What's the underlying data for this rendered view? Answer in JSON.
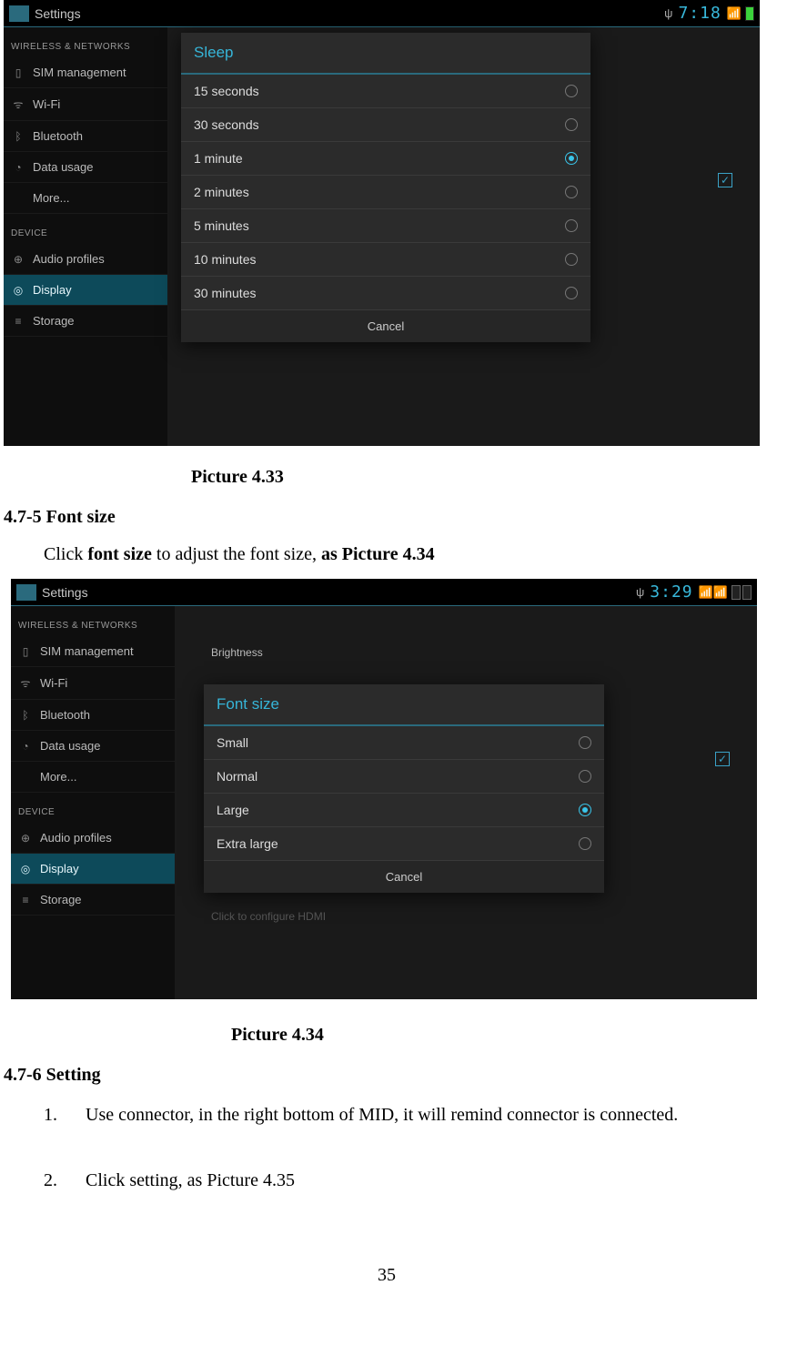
{
  "screenshot1": {
    "status": {
      "title": "Settings",
      "time": "7:18",
      "psi": "ψ"
    },
    "sidebar": {
      "headerWireless": "WIRELESS & NETWORKS",
      "headerDevice": "DEVICE",
      "items": [
        {
          "label": "SIM management",
          "icon": "▯"
        },
        {
          "label": "Wi-Fi",
          "icon": "ᯤ"
        },
        {
          "label": "Bluetooth",
          "icon": "ᛒ"
        },
        {
          "label": "Data usage",
          "icon": "◔"
        },
        {
          "label": "More...",
          "icon": ""
        }
      ],
      "deviceItems": [
        {
          "label": "Audio profiles",
          "icon": "⊕"
        },
        {
          "label": "Display",
          "icon": "◎",
          "selected": true
        },
        {
          "label": "Storage",
          "icon": "≡"
        }
      ]
    },
    "dialog": {
      "title": "Sleep",
      "options": [
        {
          "label": "15 seconds",
          "selected": false
        },
        {
          "label": "30 seconds",
          "selected": false
        },
        {
          "label": "1 minute",
          "selected": true
        },
        {
          "label": "2 minutes",
          "selected": false
        },
        {
          "label": "5 minutes",
          "selected": false
        },
        {
          "label": "10 minutes",
          "selected": false
        },
        {
          "label": "30 minutes",
          "selected": false
        }
      ],
      "cancel": "Cancel"
    }
  },
  "screenshot2": {
    "status": {
      "title": "Settings",
      "time": "3:29",
      "psi": "ψ"
    },
    "sidebar": {
      "headerWireless": "WIRELESS & NETWORKS",
      "headerDevice": "DEVICE",
      "items": [
        {
          "label": "SIM management",
          "icon": "▯"
        },
        {
          "label": "Wi-Fi",
          "icon": "ᯤ"
        },
        {
          "label": "Bluetooth",
          "icon": "ᛒ"
        },
        {
          "label": "Data usage",
          "icon": "◔"
        },
        {
          "label": "More...",
          "icon": ""
        }
      ],
      "deviceItems": [
        {
          "label": "Audio profiles",
          "icon": "⊕"
        },
        {
          "label": "Display",
          "icon": "◎",
          "selected": true
        },
        {
          "label": "Storage",
          "icon": "≡"
        }
      ]
    },
    "main": {
      "topRow": "Brightness",
      "hiddenRow": "Click to configure HDMI"
    },
    "dialog": {
      "title": "Font size",
      "options": [
        {
          "label": "Small",
          "selected": false
        },
        {
          "label": "Normal",
          "selected": false
        },
        {
          "label": "Large",
          "selected": true
        },
        {
          "label": "Extra large",
          "selected": false
        }
      ],
      "cancel": "Cancel"
    }
  },
  "doc": {
    "caption1": "Picture 4.33",
    "h475": "4.7-5 Font size",
    "p475_a": "Click ",
    "p475_b": "font size",
    "p475_c": " to adjust the font size, ",
    "p475_d": "as Picture 4.34",
    "caption2": "Picture 4.34",
    "h476": "4.7-6 Setting",
    "li1_num": "1.",
    "li1_text": "Use connector, in the right bottom of MID, it will remind connector is  connected.",
    "li2_num": "2.",
    "li2_text": "Click  setting, as Picture 4.35",
    "pagenum": "35"
  }
}
